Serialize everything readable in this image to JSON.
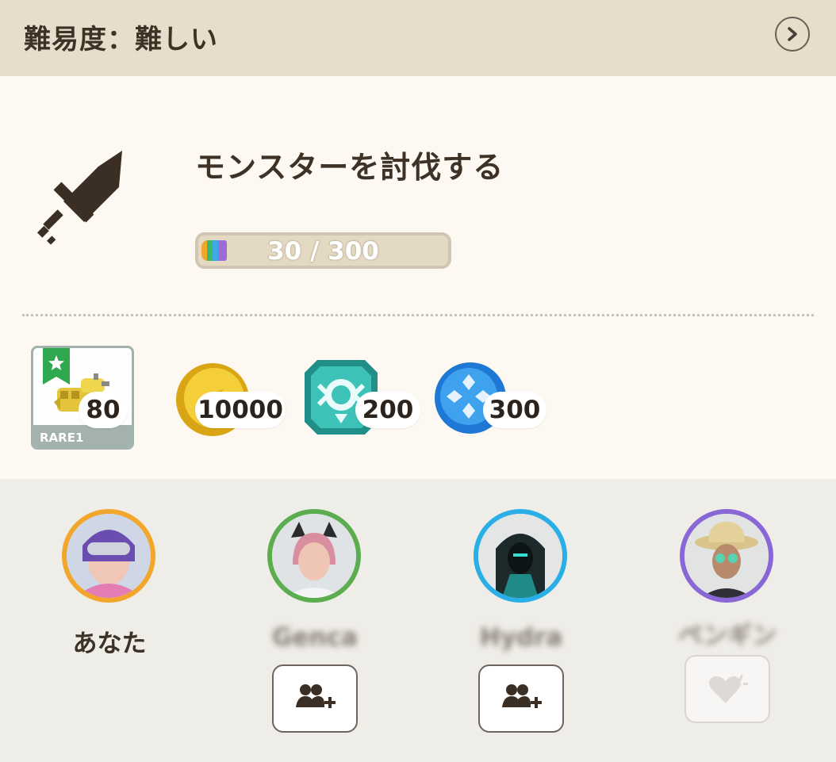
{
  "header": {
    "title": "難易度：難しい"
  },
  "mission": {
    "title": "モンスターを討伐する",
    "progress_text": "30 / 300",
    "progress_current": 30,
    "progress_total": 300
  },
  "rewards": [
    {
      "name": "item",
      "rarity": "RARE1",
      "quantity": "80"
    },
    {
      "name": "coin",
      "quantity": "10000"
    },
    {
      "name": "gem",
      "quantity": "200"
    },
    {
      "name": "orb",
      "quantity": "300"
    }
  ],
  "players": [
    {
      "name": "あなた",
      "ring_color": "#f2a62b"
    },
    {
      "name": "Genca",
      "ring_color": "#5bad4f"
    },
    {
      "name": "Hydra",
      "ring_color": "#2aaee6"
    },
    {
      "name": "ペンギン",
      "ring_color": "#8a67d6"
    }
  ],
  "colors": {
    "header_bg": "#e6ddcb",
    "card_bg": "#fdf9f2",
    "panel_bg": "#efede8"
  }
}
